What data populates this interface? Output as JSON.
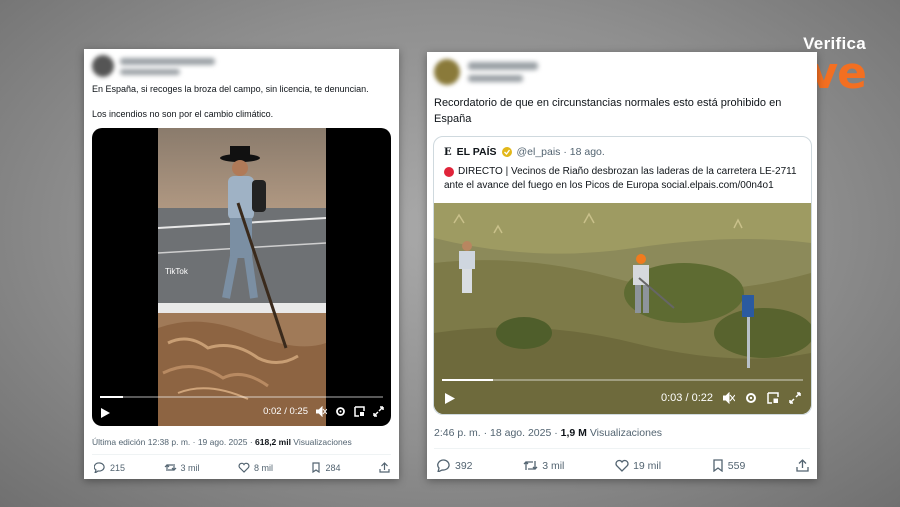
{
  "brand": {
    "verifica": "Verifica",
    "rtve": "rtve"
  },
  "post1": {
    "text_line1": "En España, si recoges la broza del campo, sin licencia, te denuncian.",
    "text_line2": "Los incendios no son por el cambio climático.",
    "watermark": "TikTok",
    "video_time": "0:02 / 0:25",
    "video_progress": 0.08,
    "meta_edit": "Última edición 12:38 p. m. · 19 ago. 2025 · ",
    "views": "618,2 mil",
    "views_label": " Visualizaciones",
    "replies": "215",
    "reposts": "3 mil",
    "likes": "8 mil",
    "bookmarks": "284"
  },
  "post2": {
    "text": "Recordatorio de que en circunstancias normales esto está prohibido en España",
    "quote": {
      "logo": "E",
      "name": "EL PAÍS",
      "handle": "@el_pais · 18 ago.",
      "text_line1": "DIRECTO | Vecinos de Riaño desbrozan las laderas de la carretera LE-2711",
      "text_line2": "ante el avance del fuego en los Picos de Europa  social.elpais.com/00n4o1",
      "video_time": "0:03 / 0:22",
      "video_progress": 0.14
    },
    "meta_time": "2:46 p. m. · 18 ago. 2025 · ",
    "views": "1,9 M",
    "views_label": " Visualizaciones",
    "replies": "392",
    "reposts": "3 mil",
    "likes": "19 mil",
    "bookmarks": "559"
  }
}
